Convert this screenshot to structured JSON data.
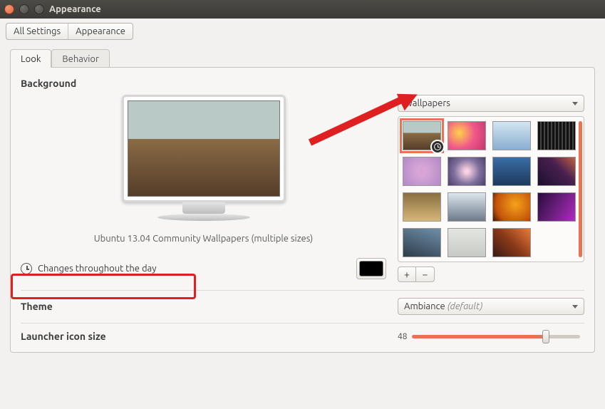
{
  "window": {
    "title": "Appearance"
  },
  "breadcrumb": {
    "all_settings": "All Settings",
    "appearance": "Appearance"
  },
  "tabs": {
    "look": "Look",
    "behavior": "Behavior"
  },
  "background": {
    "label": "Background",
    "source_dd": "Wallpapers",
    "current_name": "Ubuntu 13.04 Community Wallpapers  (multiple sizes)",
    "changes_text": "Changes throughout the day",
    "add_label": "+",
    "remove_label": "−"
  },
  "theme": {
    "label": "Theme",
    "value": "Ambiance",
    "default_suffix": " (default)"
  },
  "launcher": {
    "label": "Launcher icon size",
    "value": "48"
  }
}
